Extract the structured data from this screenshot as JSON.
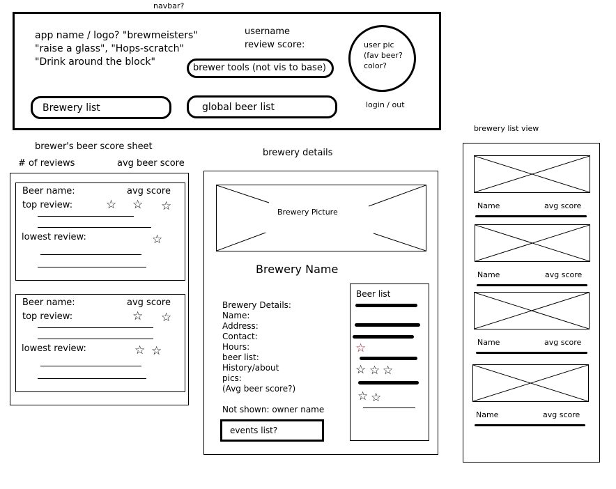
{
  "labels": {
    "navbar": "navbar?",
    "score_sheet": "brewer's beer score sheet",
    "num_reviews": "# of reviews",
    "avg_beer_score": "avg beer score",
    "brewery_details": "brewery details",
    "brewery_list_view": "brewery list view"
  },
  "navbar": {
    "app_name_lines": [
      "app name / logo? \"brewmeisters\"",
      "\"raise a glass\", \"Hops-scratch\"",
      "\"Drink around the block\""
    ],
    "username": "username",
    "review_score": "review score:",
    "brewer_tools": "brewer tools (not vis to base)",
    "user_pic_lines": [
      "user pic",
      "(fav beer?",
      "color?"
    ],
    "brewery_list": "Brewery list",
    "global_beer_list": "global beer list",
    "login": "login / out"
  },
  "score_cards": [
    {
      "beer_name": "Beer name:",
      "avg_score": "avg score",
      "top_review": "top review:",
      "lowest_review": "lowest review:",
      "top_stars": 3,
      "lowest_stars": 1
    },
    {
      "beer_name": "Beer name:",
      "avg_score": "avg score",
      "top_review": "top review:",
      "lowest_review": "lowest review:",
      "top_stars": 2,
      "lowest_stars": 2
    }
  ],
  "brewery": {
    "picture": "Brewery Picture",
    "name": "Brewery Name",
    "details": [
      "Brewery Details:",
      "Name:",
      "Address:",
      "Contact:",
      "Hours:",
      "beer list:",
      "History/about",
      "pics:",
      "(Avg beer score?)"
    ],
    "not_shown": "Not shown: owner name",
    "events": "events list?",
    "beer_list_title": "Beer list",
    "accent_star_color": "#a0102a"
  },
  "list_view": {
    "items": [
      {
        "name": "Name",
        "score": "avg score"
      },
      {
        "name": "Name",
        "score": "avg score"
      },
      {
        "name": "Name",
        "score": "avg score"
      },
      {
        "name": "Name",
        "score": "avg score"
      }
    ]
  }
}
